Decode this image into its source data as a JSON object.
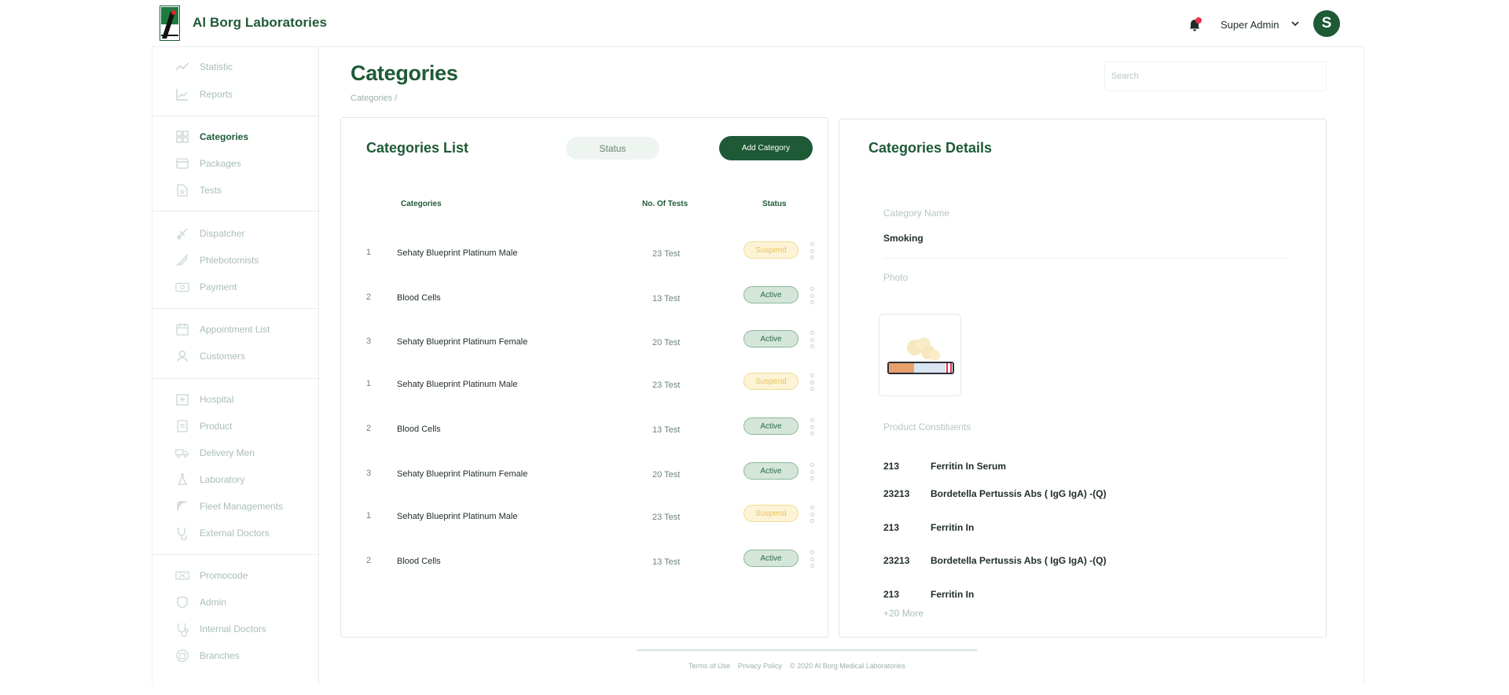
{
  "header": {
    "brand": "Al Borg Laboratories",
    "user_name": "Super Admin",
    "avatar_letter": "S",
    "notification_dot_color": "#e8314f"
  },
  "sidebar": {
    "items": [
      {
        "label": "Statistic",
        "icon": "trend-line-icon"
      },
      {
        "label": "Reports",
        "icon": "chart-icon"
      },
      {
        "label": "Categories",
        "icon": "grid-icon",
        "active": true
      },
      {
        "label": "Packages",
        "icon": "package-icon"
      },
      {
        "label": "Tests",
        "icon": "test-icon"
      },
      {
        "label": "Dispatcher",
        "icon": "dispatcher-icon"
      },
      {
        "label": "Phlebotomists",
        "icon": "syringe-icon"
      },
      {
        "label": "Payment",
        "icon": "payment-icon"
      },
      {
        "label": "Appointment List",
        "icon": "calendar-icon"
      },
      {
        "label": "Customers",
        "icon": "customers-icon"
      },
      {
        "label": "Hospital",
        "icon": "hospital-icon"
      },
      {
        "label": "Product",
        "icon": "product-icon"
      },
      {
        "label": "Delivery Men",
        "icon": "delivery-icon"
      },
      {
        "label": "Laboratory",
        "icon": "flask-icon"
      },
      {
        "label": "Fleet Managements",
        "icon": "fleet-icon"
      },
      {
        "label": "External Doctors",
        "icon": "stethoscope-icon"
      },
      {
        "label": "Promocode",
        "icon": "ticket-icon"
      },
      {
        "label": "Admin",
        "icon": "shield-icon"
      },
      {
        "label": "Internal Doctors",
        "icon": "doctor-icon"
      },
      {
        "label": "Branches",
        "icon": "branches-icon"
      }
    ]
  },
  "main": {
    "title": "Categories",
    "breadcrumb": "Categories /",
    "search_placeholder": "Search"
  },
  "list": {
    "title": "Categories List",
    "status_button": "Status",
    "add_button": "Add Category",
    "columns": {
      "category": "Categories",
      "tests": "No. Of Tests",
      "status": "Status"
    },
    "rows": [
      {
        "num": "1",
        "name": "Sehaty Blueprint Platinum Male",
        "tests": "23 Test",
        "status": "Suspend"
      },
      {
        "num": "2",
        "name": "Blood Cells",
        "tests": "13 Test",
        "status": "Active"
      },
      {
        "num": "3",
        "name": "Sehaty Blueprint Platinum Female",
        "tests": "20 Test",
        "status": "Active"
      },
      {
        "num": "1",
        "name": "Sehaty Blueprint Platinum Male",
        "tests": "23 Test",
        "status": "Suspend"
      },
      {
        "num": "2",
        "name": "Blood Cells",
        "tests": "13 Test",
        "status": "Active"
      },
      {
        "num": "3",
        "name": "Sehaty Blueprint Platinum Female",
        "tests": "20 Test",
        "status": "Active"
      },
      {
        "num": "1",
        "name": "Sehaty Blueprint Platinum Male",
        "tests": "23 Test",
        "status": "Suspend"
      },
      {
        "num": "2",
        "name": "Blood Cells",
        "tests": "13 Test",
        "status": "Active"
      }
    ]
  },
  "details": {
    "title": "Categories Details",
    "category_name_label": "Category Name",
    "category_name_value": "Smoking",
    "photo_label": "Photo",
    "constituents_label": "Product Constituents",
    "constituents": [
      {
        "code": "213",
        "name": "Ferritin In Serum"
      },
      {
        "code": "23213",
        "name": "Bordetella Pertussis Abs ( IgG IgA) -(Q)"
      },
      {
        "code": "213",
        "name": "Ferritin In"
      },
      {
        "code": "23213",
        "name": "Bordetella Pertussis Abs ( IgG IgA) -(Q)"
      },
      {
        "code": "213",
        "name": "Ferritin In"
      }
    ],
    "more": "+20 More"
  },
  "footer": {
    "terms": "Terms of Use",
    "privacy": "Privacy Policy",
    "copyright": "© 2020  Al Borg Medical Laboratories"
  },
  "colors": {
    "brand_green": "#1e5a36",
    "active_badge_bg": "#d4e6da",
    "suspend_badge_bg": "#fdf3d6",
    "muted_text": "#a9bfb2"
  }
}
